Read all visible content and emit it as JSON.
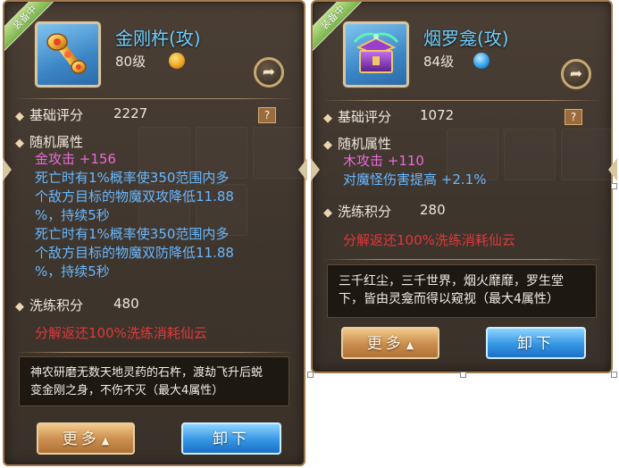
{
  "left_panel": {
    "badge": "装备中",
    "name": "金刚杵(攻)",
    "level": "80级",
    "quality_color": "#e8a020",
    "base_score_label": "基础评分",
    "base_score": "2227",
    "help_label": "?",
    "random_attr_label": "随机属性",
    "attributes": [
      {
        "text": "金攻击 +156",
        "color": "#e86ad8"
      },
      {
        "text": "死亡时有1%概率使350范围内多",
        "color": "#68b8ff"
      },
      {
        "text": "个敌方目标的物魔双攻降低11.88",
        "color": "#68b8ff"
      },
      {
        "text": "%，持续5秒",
        "color": "#68b8ff"
      },
      {
        "text": "死亡时有1%概率使350范围内多",
        "color": "#68b8ff"
      },
      {
        "text": "个敌方目标的物魔双防降低11.88",
        "color": "#68b8ff"
      },
      {
        "text": "%，持续5秒",
        "color": "#68b8ff"
      }
    ],
    "refine_label": "洗练积分",
    "refine_score": "480",
    "decompose_note": "分解返还100%洗练消耗仙云",
    "description": [
      "神农研磨无数天地灵药的石杵，渡劫飞升后蜕",
      "变金刚之身，不伤不灭（最大4属性）"
    ],
    "more_label": "更多",
    "unequip_label": "卸下"
  },
  "right_panel": {
    "badge": "装备中",
    "name": "烟罗龛(攻)",
    "level": "84级",
    "quality_color": "#2a9ae8",
    "base_score_label": "基础评分",
    "base_score": "1072",
    "help_label": "?",
    "random_attr_label": "随机属性",
    "attributes": [
      {
        "text": "木攻击 +110",
        "color": "#e86ad8"
      },
      {
        "text": "对魔怪伤害提高 +2.1%",
        "color": "#68b8ff"
      }
    ],
    "refine_label": "洗练积分",
    "refine_score": "280",
    "decompose_note": "分解返还100%洗练消耗仙云",
    "description": [
      "三千红尘，三千世界，烟火靡靡，罗生堂",
      "下，皆由灵龛而得以窥视（最大4属性）"
    ],
    "more_label": "更多",
    "unequip_label": "卸下"
  },
  "icons": {
    "share": "share-arrow-icon",
    "left_item": "golden-pestle-icon",
    "right_item": "purple-shrine-box-icon"
  }
}
